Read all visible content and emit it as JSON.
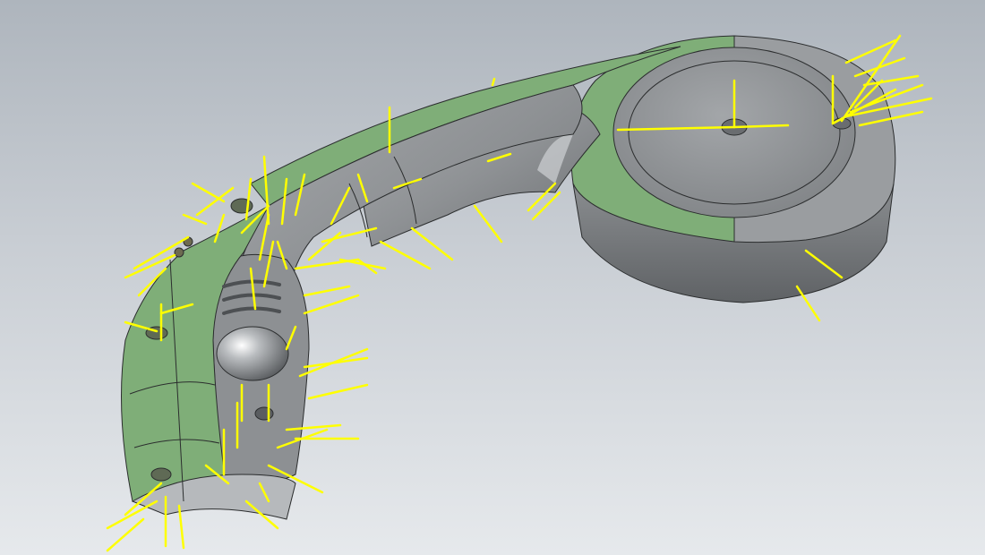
{
  "viewport": {
    "name": "cad-3d-viewport",
    "background_top": "#aeb5bd",
    "background_bottom": "#e6e9ec"
  },
  "model": {
    "type": "handheld-shower-head",
    "body_color": "#8c8f92",
    "body_edge_color": "#2b2d2e",
    "highlighted_face_color": "#7fae78",
    "analysis_vector_color": "#ffff00",
    "face_normal_vectors_visible": true
  }
}
